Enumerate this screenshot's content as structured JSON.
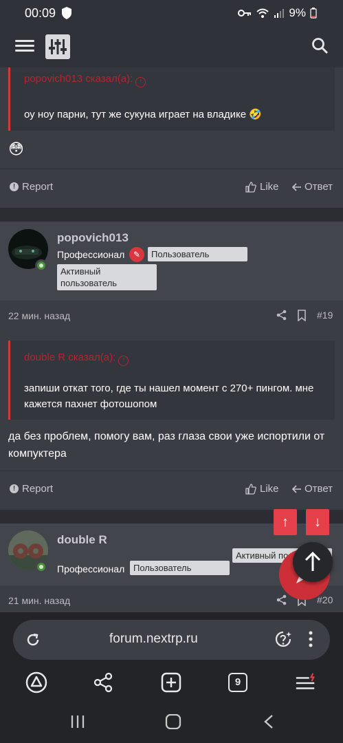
{
  "status_bar": {
    "time": "00:09",
    "battery": "9%"
  },
  "browser": {
    "url": "forum.nextrp.ru",
    "tab_count": "9"
  },
  "posts": [
    {
      "quote_author": "popovich013 сказал(а):",
      "quote_text": "оу ноу парни, тут же сукуна играет на владике 🤣",
      "text": "😳",
      "report": "Report",
      "like": "Like",
      "reply": "Ответ"
    },
    {
      "username": "popovich013",
      "rank": "Профессионал",
      "badges": [
        "Пользователь",
        "Активный пользователь"
      ],
      "time": "22 мин. назад",
      "number": "#19",
      "quote_author": "double R сказал(а):",
      "quote_text": "запиши откат того, где ты нашел момент с 270+ пингом. мне кажется пахнет фотошопом",
      "text": "да без проблем, помогу вам, раз глаза свои уже испортили от компуктера",
      "report": "Report",
      "like": "Like",
      "reply": "Ответ"
    },
    {
      "username": "double R",
      "rank": "Профессионал",
      "badges": [
        "Пользователь",
        "Активный пользовате"
      ],
      "time": "21 мин. назад",
      "number": "#20"
    }
  ],
  "colors": {
    "accent": "#e5404a",
    "background": "#2b2d33",
    "card": "#3a3d44"
  }
}
